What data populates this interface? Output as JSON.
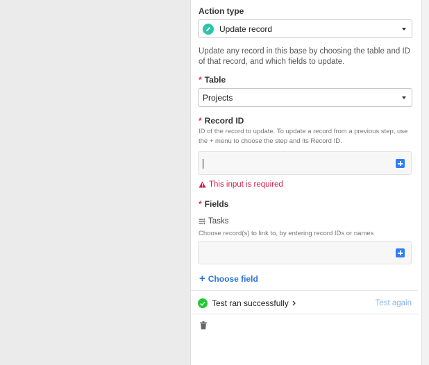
{
  "action_type": {
    "label": "Action type",
    "selected": "Update record",
    "icon": "pencil-icon",
    "icon_color": "#2ec4a9"
  },
  "description": "Update any record in this base by choosing the table and ID of that record, and which fields to update.",
  "table": {
    "required_mark": "*",
    "label": "Table",
    "selected": "Projects"
  },
  "record_id": {
    "required_mark": "*",
    "label": "Record ID",
    "hint": "ID of the record to update. To update a record from a previous step, use the + menu to choose the step and its Record ID.",
    "value": "",
    "error": "This input is required"
  },
  "fields": {
    "required_mark": "*",
    "label": "Fields",
    "items": [
      {
        "name": "Tasks",
        "icon": "linked-record-icon",
        "hint": "Choose record(s) to link to, by entering record IDs or names",
        "value": ""
      }
    ],
    "choose_field_label": "Choose field"
  },
  "test": {
    "status": "Test ran successfully",
    "again_label": "Test again",
    "success_color": "#20c933"
  },
  "colors": {
    "error": "#d6224a",
    "accent": "#2d7ff9",
    "link": "#2d72d2"
  }
}
